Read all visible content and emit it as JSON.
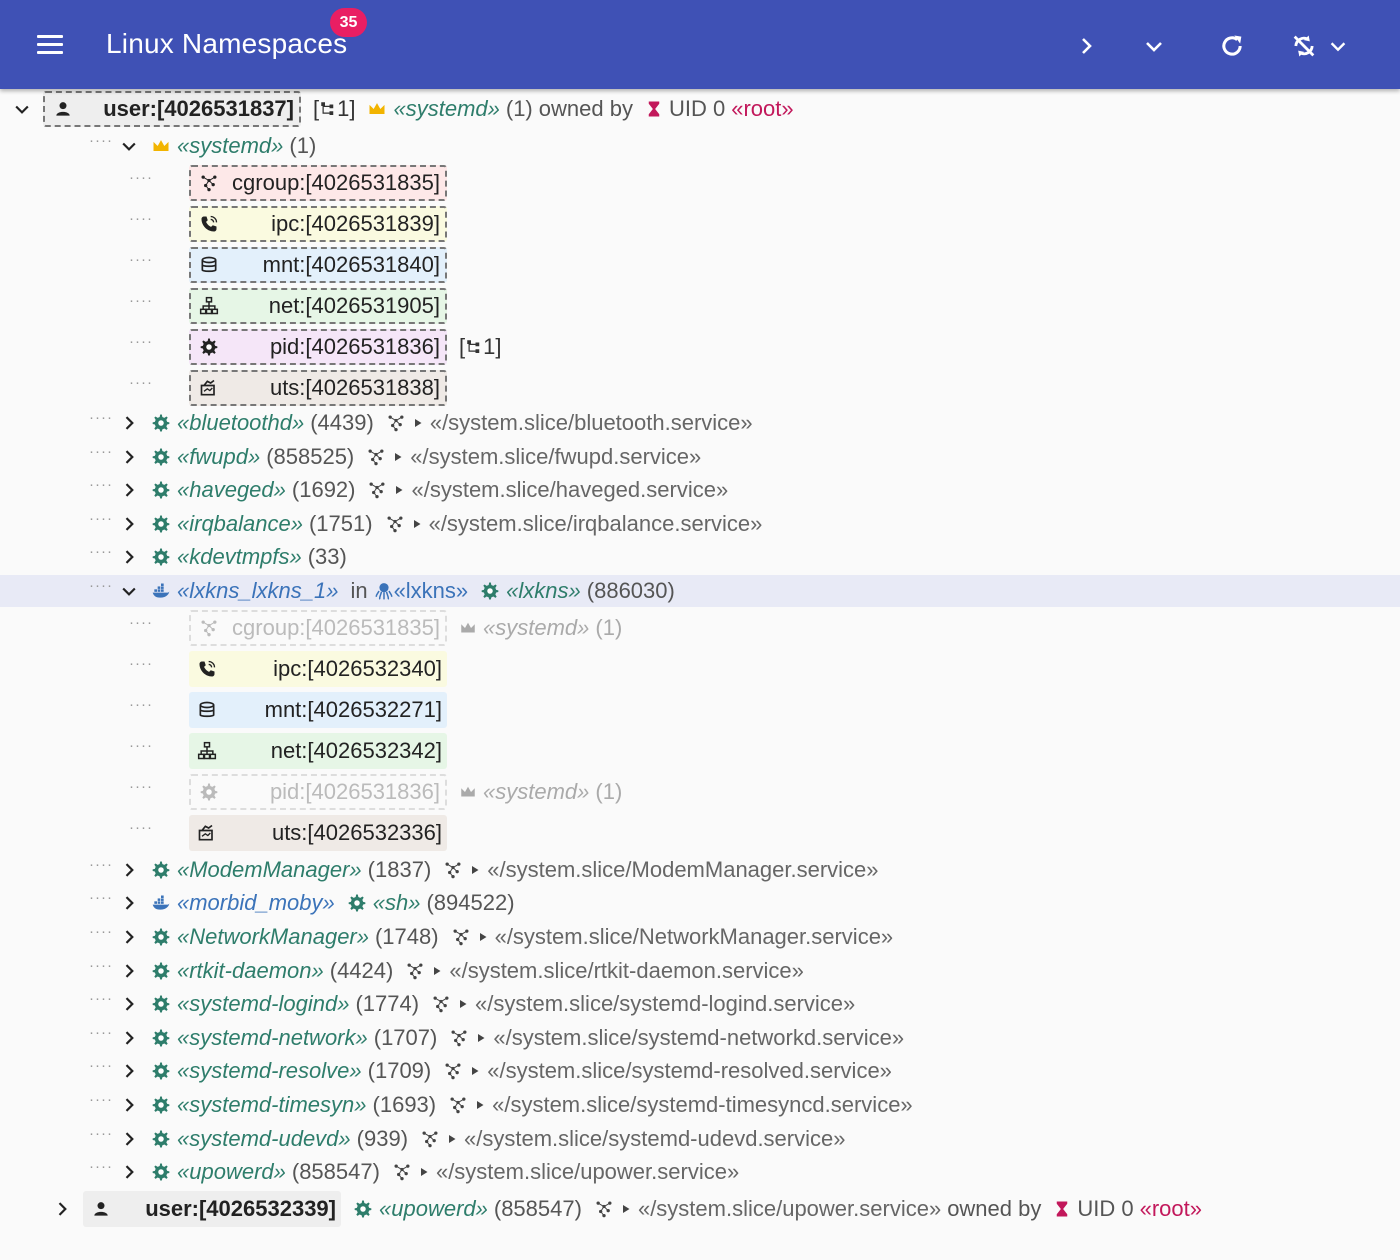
{
  "appbar": {
    "title": "Linux Namespaces",
    "badge": "35",
    "icons": [
      "menu-icon",
      "expand-icon",
      "collapse-all-icon",
      "refresh-icon",
      "sync-disabled-icon",
      "dropdown-icon"
    ]
  },
  "tree": {
    "root1": {
      "ns_label": "user:[4026531837]",
      "children_count": "[",
      "children_count_num": "1]",
      "process": "«systemd»",
      "pid": "(1)",
      "owned_by": "owned by",
      "uid": "UID 0",
      "user": "«root»"
    },
    "systemd": {
      "process": "«systemd»",
      "pid": "(1)",
      "namespaces": [
        {
          "type": "cgroup",
          "label": "cgroup:[4026531835]"
        },
        {
          "type": "ipc",
          "label": "ipc:[4026531839]"
        },
        {
          "type": "mnt",
          "label": "mnt:[4026531840]"
        },
        {
          "type": "net",
          "label": "net:[4026531905]"
        },
        {
          "type": "pid",
          "label": "pid:[4026531836]",
          "extra": "[",
          "extra_num": "1]"
        },
        {
          "type": "uts",
          "label": "uts:[4026531838]"
        }
      ]
    },
    "services_a": [
      {
        "process": "«bluetoothd»",
        "pid": "(4439)",
        "path": "«/system.slice/bluetooth.service»"
      },
      {
        "process": "«fwupd»",
        "pid": "(858525)",
        "path": "«/system.slice/fwupd.service»"
      },
      {
        "process": "«haveged»",
        "pid": "(1692)",
        "path": "«/system.slice/haveged.service»"
      },
      {
        "process": "«irqbalance»",
        "pid": "(1751)",
        "path": "«/system.slice/irqbalance.service»"
      },
      {
        "process": "«kdevtmpfs»",
        "pid": "(33)",
        "path": ""
      }
    ],
    "container": {
      "name": "«lxkns_lxkns_1»",
      "in": "in",
      "engine": "«lxkns",
      "engine_close": "»",
      "process": "«lxkns»",
      "pid": "(886030)",
      "namespaces": [
        {
          "type": "cgroup",
          "label": "cgroup:[4026531835]",
          "shared": true,
          "owner_process": "«systemd»",
          "owner_pid": "(1)"
        },
        {
          "type": "ipc",
          "label": "ipc:[4026532340]"
        },
        {
          "type": "mnt",
          "label": "mnt:[4026532271]"
        },
        {
          "type": "net",
          "label": "net:[4026532342]"
        },
        {
          "type": "pid",
          "label": "pid:[4026531836]",
          "shared": true,
          "owner_process": "«systemd»",
          "owner_pid": "(1)"
        },
        {
          "type": "uts",
          "label": "uts:[4026532336]"
        }
      ]
    },
    "services_b": [
      {
        "kind": "service",
        "process": "«ModemManager»",
        "pid": "(1837)",
        "path": "«/system.slice/ModemManager.service»"
      },
      {
        "kind": "container",
        "process": "«morbid_moby»",
        "sub_process": "«sh»",
        "pid": "(894522)",
        "path": ""
      },
      {
        "kind": "service",
        "process": "«NetworkManager»",
        "pid": "(1748)",
        "path": "«/system.slice/NetworkManager.service»"
      },
      {
        "kind": "service",
        "process": "«rtkit-daemon»",
        "pid": "(4424)",
        "path": "«/system.slice/rtkit-daemon.service»"
      },
      {
        "kind": "service",
        "process": "«systemd-logind»",
        "pid": "(1774)",
        "path": "«/system.slice/systemd-logind.service»"
      },
      {
        "kind": "service",
        "process": "«systemd-network»",
        "pid": "(1707)",
        "path": "«/system.slice/systemd-networkd.service»"
      },
      {
        "kind": "service",
        "process": "«systemd-resolve»",
        "pid": "(1709)",
        "path": "«/system.slice/systemd-resolved.service»"
      },
      {
        "kind": "service",
        "process": "«systemd-timesyn»",
        "pid": "(1693)",
        "path": "«/system.slice/systemd-timesyncd.service»"
      },
      {
        "kind": "service",
        "process": "«systemd-udevd»",
        "pid": "(939)",
        "path": "«/system.slice/systemd-udevd.service»"
      },
      {
        "kind": "service",
        "process": "«upowerd»",
        "pid": "(858547)",
        "path": "«/system.slice/upower.service»"
      }
    ],
    "root2": {
      "ns_label": "user:[4026532339]",
      "process": "«upowerd»",
      "pid": "(858547)",
      "path": "«/system.slice/upower.service»",
      "owned_by": "owned by",
      "uid": "UID 0",
      "user": "«root»"
    },
    "dots": "····"
  },
  "colors": {
    "appbar": "#3f51b5",
    "badge": "#e91e63",
    "process": "#2e7d6b",
    "container": "#3b73b9",
    "root_user": "#c2185b",
    "crown": "#f2b400"
  }
}
